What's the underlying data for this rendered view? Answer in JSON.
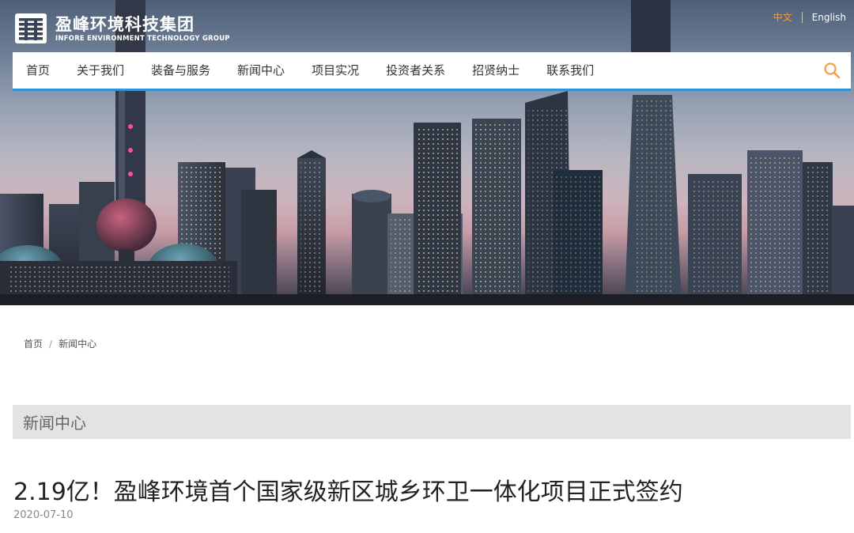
{
  "brand": {
    "name_cn": "盈峰环境科技集团",
    "name_en": "INFORE ENVIRONMENT TECHNOLOGY GROUP",
    "logo_icon": "infore-logo-icon"
  },
  "language": {
    "zh_label": "中文",
    "en_label": "English",
    "active_color": "#f0a040"
  },
  "nav": {
    "items": [
      {
        "label": "首页"
      },
      {
        "label": "关于我们"
      },
      {
        "label": "装备与服务"
      },
      {
        "label": "新闻中心"
      },
      {
        "label": "项目实况"
      },
      {
        "label": "投资者关系"
      },
      {
        "label": "招贤纳士"
      },
      {
        "label": "联系我们"
      }
    ],
    "search_icon": "search-icon",
    "accent_color": "#2f93d8",
    "search_color": "#f0a040"
  },
  "breadcrumb": {
    "home": "首页",
    "separator": "/",
    "current": "新闻中心"
  },
  "section": {
    "title": "新闻中心"
  },
  "article": {
    "title": "2.19亿！盈峰环境首个国家级新区城乡环卫一体化项目正式签约",
    "date": "2020-07-10"
  }
}
